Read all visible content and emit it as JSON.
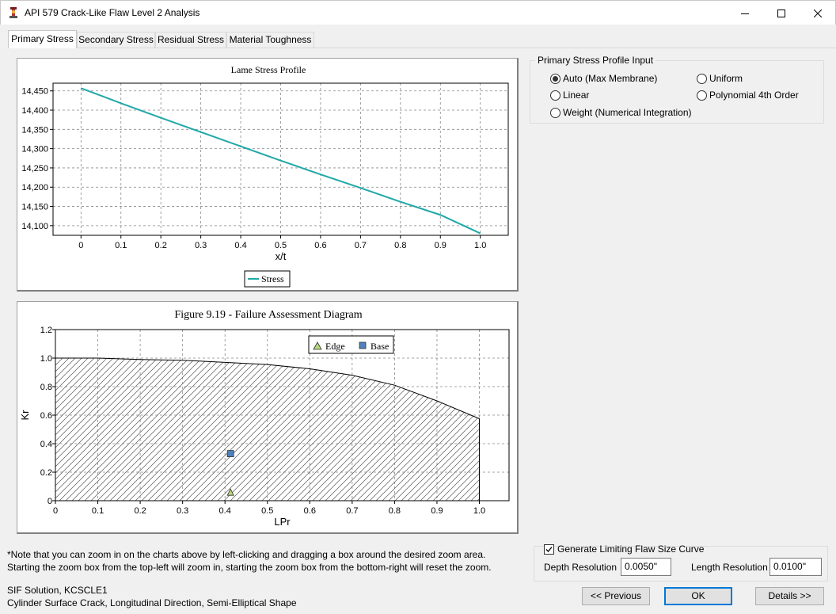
{
  "window": {
    "title": "API 579 Crack-Like Flaw Level 2 Analysis"
  },
  "tabs": [
    {
      "label": "Primary Stress",
      "active": true
    },
    {
      "label": "Secondary Stress",
      "active": false
    },
    {
      "label": "Residual Stress",
      "active": false
    },
    {
      "label": "Material Toughness",
      "active": false
    }
  ],
  "chart_data": [
    {
      "type": "line",
      "title": "Lame Stress Profile",
      "xlabel": "x/t",
      "ylabel": "",
      "xlim": [
        -0.07,
        1.07
      ],
      "ylim": [
        14075,
        14470
      ],
      "x_ticks": [
        0,
        0.1,
        0.2,
        0.3,
        0.4,
        0.5,
        0.6,
        0.7,
        0.8,
        0.9,
        1.0
      ],
      "x_tick_labels": [
        "0",
        "0.1",
        "0.2",
        "0.3",
        "0.4",
        "0.5",
        "0.6",
        "0.7",
        "0.8",
        "0.9",
        "1.0"
      ],
      "y_ticks": [
        14100,
        14150,
        14200,
        14250,
        14300,
        14350,
        14400,
        14450
      ],
      "y_tick_labels": [
        "14,100",
        "14,150",
        "14,200",
        "14,250",
        "14,300",
        "14,350",
        "14,400",
        "14,450"
      ],
      "grid": true,
      "legend": "bottom-center",
      "series": [
        {
          "name": "Stress",
          "color": "#20a8a8",
          "x": [
            0,
            0.1,
            0.2,
            0.3,
            0.4,
            0.5,
            0.6,
            0.7,
            0.8,
            0.9,
            1.0
          ],
          "y": [
            14457,
            14418,
            14380,
            14343,
            14306,
            14269,
            14233,
            14198,
            14162,
            14128,
            14080
          ]
        }
      ]
    },
    {
      "type": "scatter",
      "title": "Figure 9.19 - Failure Assessment Diagram",
      "xlabel": "LPr",
      "ylabel": "Kr",
      "xlim": [
        0,
        1.07
      ],
      "ylim": [
        0,
        1.2
      ],
      "x_ticks": [
        0,
        0.1,
        0.2,
        0.3,
        0.4,
        0.5,
        0.6,
        0.7,
        0.8,
        0.9,
        1.0
      ],
      "x_tick_labels": [
        "0",
        "0.1",
        "0.2",
        "0.3",
        "0.4",
        "0.5",
        "0.6",
        "0.7",
        "0.8",
        "0.9",
        "1.0"
      ],
      "y_ticks": [
        0,
        0.2,
        0.4,
        0.6,
        0.8,
        1.0,
        1.2
      ],
      "y_tick_labels": [
        "0",
        "0.2",
        "0.4",
        "0.6",
        "0.8",
        "1.0",
        "1.2"
      ],
      "grid": true,
      "legend": "top-right",
      "fad_curve": {
        "x": [
          0,
          0.1,
          0.2,
          0.3,
          0.4,
          0.5,
          0.6,
          0.7,
          0.8,
          0.9,
          1.0
        ],
        "y": [
          1.0,
          1.0,
          0.99,
          0.985,
          0.97,
          0.955,
          0.925,
          0.88,
          0.81,
          0.7,
          0.575
        ]
      },
      "series": [
        {
          "name": "Edge",
          "marker": "triangle",
          "color": "#b5d67a",
          "x": [
            0.413
          ],
          "y": [
            0.06
          ]
        },
        {
          "name": "Base",
          "marker": "square",
          "color": "#4f81bd",
          "x": [
            0.413
          ],
          "y": [
            0.33
          ]
        }
      ]
    }
  ],
  "stress_profile": {
    "group_label": "Primary Stress Profile Input",
    "options": [
      {
        "label": "Auto (Max Membrane)",
        "selected": true
      },
      {
        "label": "Uniform",
        "selected": false
      },
      {
        "label": "Linear",
        "selected": false
      },
      {
        "label": "Polynomial 4th Order",
        "selected": false
      },
      {
        "label": "Weight (Numerical Integration)",
        "selected": false
      }
    ]
  },
  "note": {
    "line1": "*Note that you can zoom in on the charts above by left-clicking and dragging a box around the desired zoom area.",
    "line2": "Starting the zoom box from the top-left will zoom in, starting the zoom box from the bottom-right will reset the zoom."
  },
  "sif": {
    "line1": "SIF Solution, KCSCLE1",
    "line2": "Cylinder Surface Crack, Longitudinal Direction, Semi-Elliptical Shape"
  },
  "limiting": {
    "checkbox_label": "Generate Limiting Flaw Size Curve",
    "checked": true,
    "depth_label": "Depth Resolution",
    "depth_value": "0.0050\"",
    "length_label": "Length Resolution",
    "length_value": "0.0100\""
  },
  "buttons": {
    "previous": "<< Previous",
    "ok": "OK",
    "details": "Details >>"
  },
  "colors": {
    "accent": "#0078d7",
    "stress_line": "#20a8a8"
  }
}
